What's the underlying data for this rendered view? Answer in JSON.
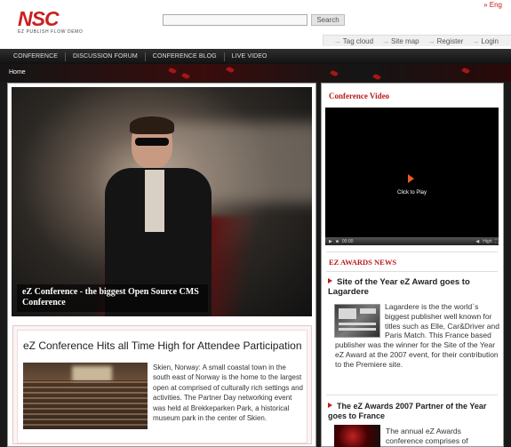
{
  "header": {
    "logo_text": "NSC",
    "logo_subtitle": "EZ PUBLISH FLOW DEMO",
    "language_link": "» Eng",
    "search": {
      "value": "",
      "button_label": "Search"
    },
    "utility_links": [
      "Tag cloud",
      "Site map",
      "Register",
      "Login"
    ]
  },
  "nav": {
    "items": [
      "CONFERENCE",
      "DISCUSSION FORUM",
      "CONFERENCE BLOG",
      "LIVE VIDEO"
    ]
  },
  "breadcrumb": {
    "home": "Home"
  },
  "main": {
    "hero_caption": "eZ Conference - the biggest Open Source CMS Conference",
    "article": {
      "title": "eZ Conference Hits all Time High for Attendee Participation",
      "text": "Skien, Norway: A small coastal town in the south east of Norway is the home to the largest open at comprised of culturally rich settings and activities. The Partner Day networking event was held at Brekkeparken Park, a historical museum park in the center of Skien."
    }
  },
  "sidebar": {
    "video": {
      "title": "Conference Video",
      "play_label": "Click to Play",
      "time": "00:00",
      "quality": "High"
    },
    "news": {
      "title": "EZ AWARDS NEWS",
      "items": [
        {
          "title": "Site of the Year eZ Award goes to Lagardere",
          "text": "Lagardere is the the world`s biggest publisher well known for titles such as Elle, Car&Driver and Paris Match. This France based publisher was the winner for the Site of the Year eZ Award at the 2007 event, for their contribution to the Premiere site."
        },
        {
          "title": "The eZ Awards 2007 Partner of the Year goes to France",
          "text": "The annual eZ Awards conference comprises of"
        }
      ]
    }
  },
  "colors": {
    "brand_red": "#cc1f1f",
    "nav_bg": "#1f1f1f"
  }
}
